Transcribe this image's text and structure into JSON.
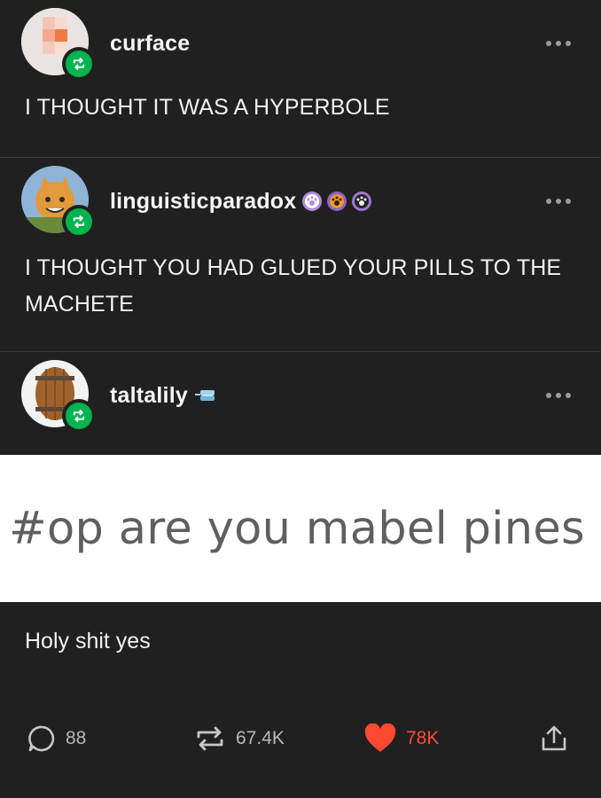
{
  "colors": {
    "background": "#202020",
    "reblog_green": "#00b44e",
    "like_red": "#ff4930",
    "divider": "#3a3a3a"
  },
  "posts": [
    {
      "username": "curface",
      "text": "I THOUGHT IT WAS A HYPERBOLE"
    },
    {
      "username": "linguisticparadox",
      "text": "I THOUGHT YOU HAD GLUED YOUR PILLS TO THE MACHETE"
    },
    {
      "username": "taltalily",
      "tag": "#op are you mabel pines",
      "reply": "Holy shit yes"
    }
  ],
  "footer": {
    "comments": "88",
    "reblogs": "67.4K",
    "likes": "78K",
    "icons": [
      "comment-icon",
      "reblog-icon",
      "heart-icon",
      "share-icon"
    ]
  }
}
